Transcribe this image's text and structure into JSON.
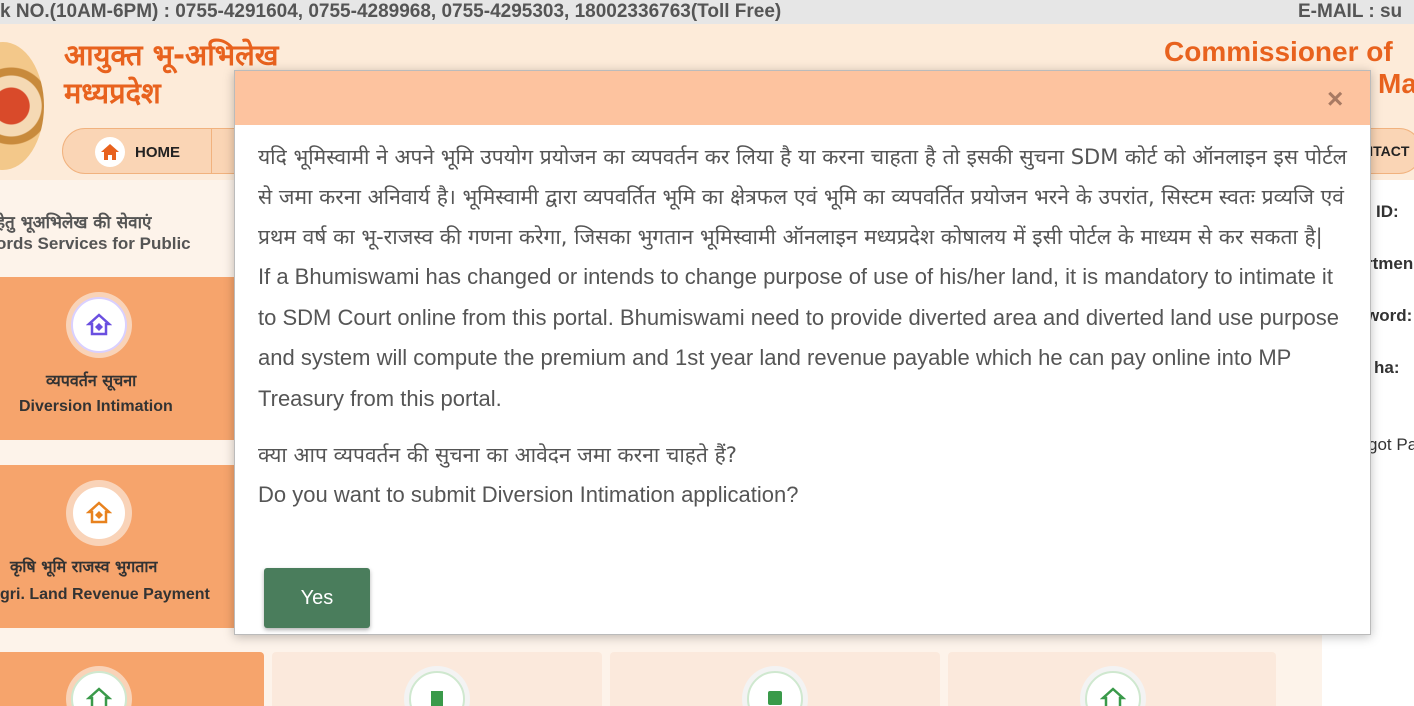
{
  "topbar": {
    "helpline": "k NO.(10AM-6PM) : 0755-4291604, 0755-4289968, 0755-4295303, 18002336763(Toll Free)",
    "email": "E-MAIL : su"
  },
  "header": {
    "title_hi_line1": "आयुक्त भू-अभिलेख",
    "title_hi_line2": "मध्यप्रदेश",
    "title_en_line1": "Commissioner of",
    "title_en_line2": "Ma"
  },
  "nav": {
    "home": "HOME",
    "contact": "NTACT"
  },
  "services": {
    "heading_hi": "हेतु भूअभिलेख की सेवाएं",
    "heading_en": "ords Services for Public",
    "cards": [
      {
        "hi": "व्यपवर्तन सूचना",
        "en": "Diversion Intimation"
      },
      {
        "hi": "कृषि भूमि राजस्व भुगतान",
        "en": "gri. Land Revenue Payment"
      }
    ]
  },
  "login": {
    "labels": [
      "ID:",
      "rtmen",
      "word:",
      "ha:",
      "got Pa"
    ]
  },
  "modal": {
    "close": "×",
    "para_hi": "यदि भूमिस्वामी ने अपने भूमि उपयोग प्रयोजन का व्यपवर्तन कर लिया है या करना चाहता है तो इसकी सुचना SDM कोर्ट को ऑनलाइन इस पोर्टल से जमा करना अनिवार्य है। भूमिस्वामी द्वारा व्यपवर्तित भूमि का क्षेत्रफल एवं भूमि का व्यपवर्तित प्रयोजन भरने के उपरांत, सिस्टम स्वतः प्रव्यजि एवं प्रथम वर्ष का भू-राजस्व की गणना करेगा, जिसका भुगतान भूमिस्वामी ऑनलाइन मध्यप्रदेश कोषालय में इसी पोर्टल के माध्यम से कर सकता है|",
    "para_en": "If a Bhumiswami has changed or intends to change purpose of use of his/her land, it is mandatory to intimate it to SDM Court online from this portal. Bhumiswami need to provide diverted area and diverted land use purpose and system will compute the premium and 1st year land revenue payable which he can pay online into MP Treasury from this portal.",
    "question_hi": "क्या आप व्यपवर्तन की सुचना का आवेदन जमा करना चाहते हैं?",
    "question_en": "Do you want to submit Diversion Intimation application?",
    "yes_label": "Yes"
  }
}
